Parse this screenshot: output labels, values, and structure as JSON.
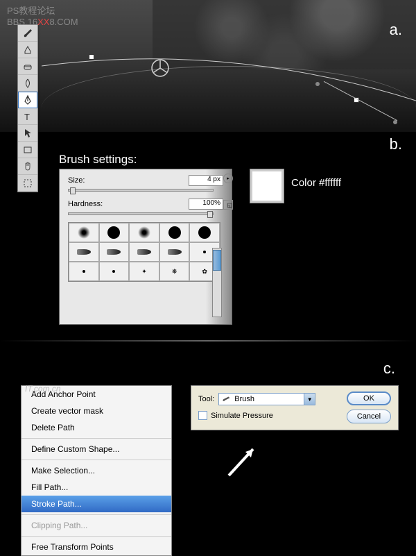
{
  "watermark": {
    "line1": "PS教程论坛",
    "line2_a": "BBS.16",
    "line2_b": "XX",
    "line2_c": "8.COM"
  },
  "labels": {
    "a": "a.",
    "b": "b.",
    "c": "c."
  },
  "toolbar": {
    "tools": [
      "brush",
      "eraser",
      "gradient",
      "dodge",
      "pen",
      "type",
      "path-select",
      "direct-select",
      "rectangle",
      "sponge"
    ]
  },
  "brush": {
    "title": "Brush settings:",
    "size_label": "Size:",
    "size_value": "4 px",
    "hardness_label": "Hardness:",
    "hardness_value": "100%"
  },
  "color": {
    "label": "Color #ffffff",
    "value": "#ffffff"
  },
  "context_menu": {
    "watermark": "IT.com.cn",
    "items": [
      {
        "label": "Add Anchor Point",
        "type": "item"
      },
      {
        "label": "Create vector mask",
        "type": "item"
      },
      {
        "label": "Delete Path",
        "type": "item"
      },
      {
        "type": "sep"
      },
      {
        "label": "Define Custom Shape...",
        "type": "item"
      },
      {
        "type": "sep"
      },
      {
        "label": "Make Selection...",
        "type": "item"
      },
      {
        "label": "Fill Path...",
        "type": "item"
      },
      {
        "label": "Stroke Path...",
        "type": "highlighted"
      },
      {
        "type": "sep"
      },
      {
        "label": "Clipping Path...",
        "type": "disabled"
      },
      {
        "type": "sep"
      },
      {
        "label": "Free Transform Points",
        "type": "item"
      }
    ]
  },
  "stroke_dialog": {
    "tool_label": "Tool:",
    "tool_value": "Brush",
    "simulate_label": "Simulate Pressure",
    "ok": "OK",
    "cancel": "Cancel"
  }
}
